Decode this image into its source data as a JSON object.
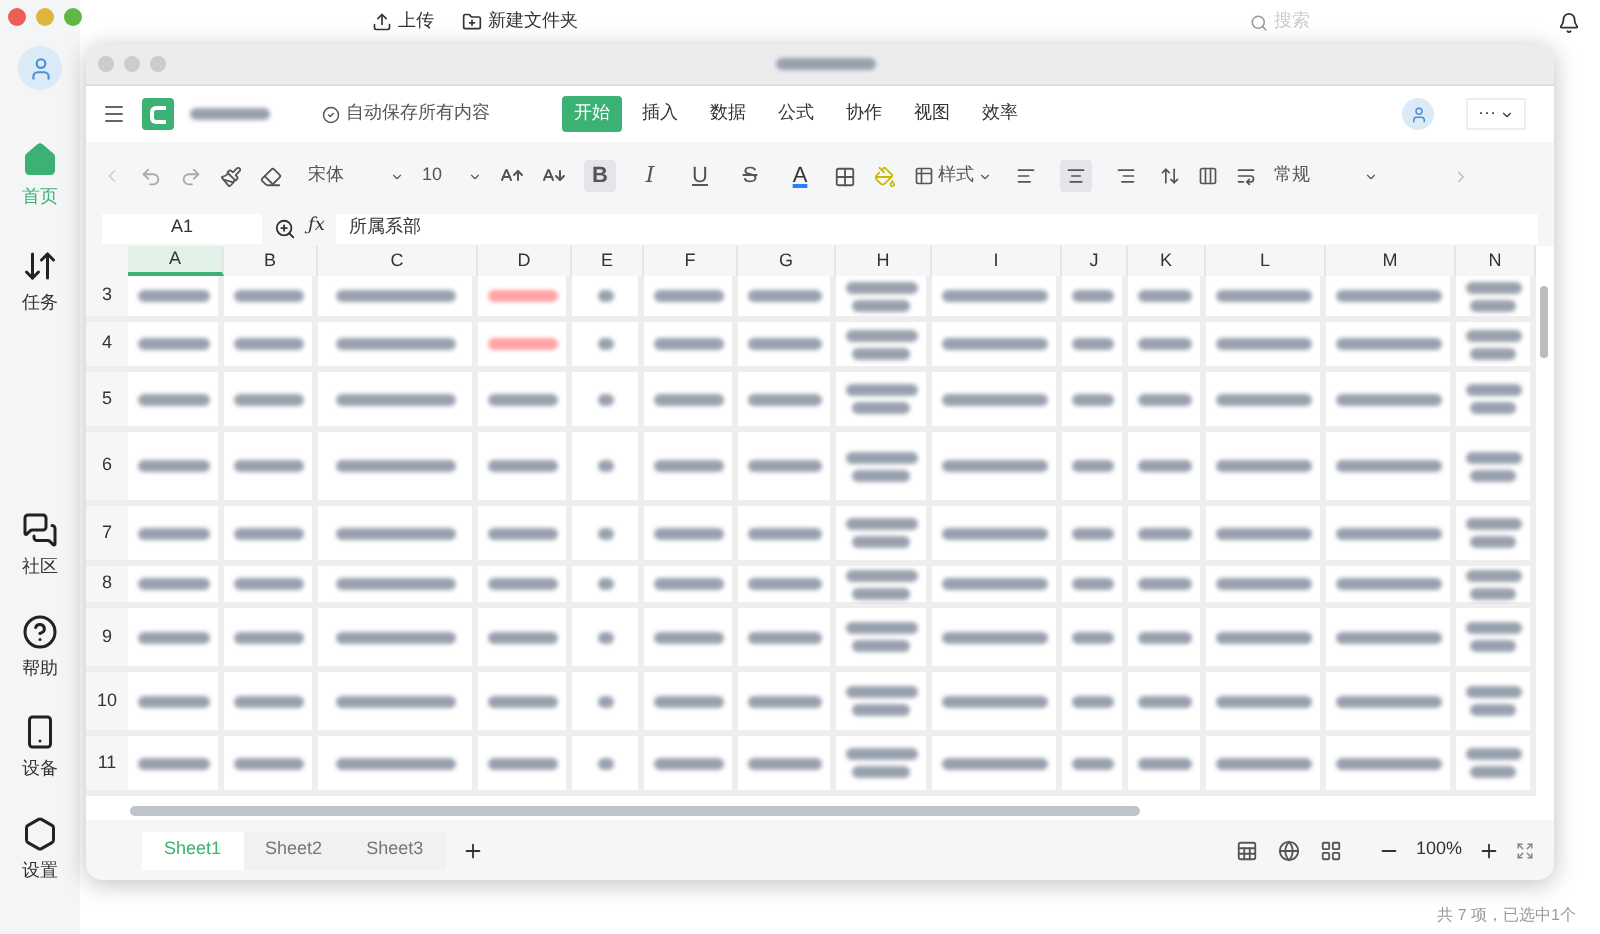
{
  "sidebar": {
    "items": [
      {
        "label": "首页",
        "kind": "home",
        "selected": true
      },
      {
        "label": "任务",
        "kind": "tasks",
        "selected": false
      },
      {
        "label": "社区",
        "kind": "community",
        "selected": false
      },
      {
        "label": "帮助",
        "kind": "help",
        "selected": false
      },
      {
        "label": "设备",
        "kind": "device",
        "selected": false
      },
      {
        "label": "设置",
        "kind": "settings",
        "selected": false
      }
    ]
  },
  "background_header": {
    "actions": [
      "上传",
      "新建文件夹"
    ],
    "search": {
      "placeholder": "搜索"
    }
  },
  "spreadsheet": {
    "autosave": "自动保存所有内容",
    "menu_tabs": [
      {
        "label": "开始",
        "selected": true
      },
      {
        "label": "插入",
        "selected": false
      },
      {
        "label": "数据",
        "selected": false
      },
      {
        "label": "公式",
        "selected": false
      },
      {
        "label": "协作",
        "selected": false
      },
      {
        "label": "视图",
        "selected": false
      },
      {
        "label": "效率",
        "selected": false
      }
    ],
    "more": "···",
    "toolbar": {
      "font": "宋体",
      "size": "10",
      "format_buttons": [
        {
          "label": "B",
          "kind": "bold",
          "selected": true
        },
        {
          "label": "I",
          "kind": "italic",
          "selected": false
        },
        {
          "label": "U",
          "kind": "underline",
          "selected": false
        },
        {
          "label": "S",
          "kind": "strike",
          "selected": false
        },
        {
          "label": "A",
          "kind": "color",
          "selected": false
        }
      ],
      "style": "样式",
      "align_buttons": [
        {
          "kind": "left",
          "selected": false
        },
        {
          "kind": "center",
          "selected": true
        },
        {
          "kind": "right",
          "selected": false
        }
      ],
      "number_format": "常规"
    },
    "cell_ref": "A1",
    "function_label": "ƒx",
    "formula": "所属系部",
    "columns": [
      "A",
      "B",
      "C",
      "D",
      "E",
      "F",
      "G",
      "H",
      "I",
      "J",
      "K",
      "L",
      "M",
      "N"
    ],
    "rows": [
      "3",
      "4",
      "5",
      "6",
      "7",
      "8",
      "9",
      "10",
      "11"
    ],
    "sheets": [
      {
        "label": "Sheet1",
        "selected": true
      },
      {
        "label": "Sheet2",
        "selected": false
      },
      {
        "label": "Sheet3",
        "selected": false
      }
    ],
    "zoom": "100%"
  },
  "status_bar": "共 7 项，已选中1个"
}
